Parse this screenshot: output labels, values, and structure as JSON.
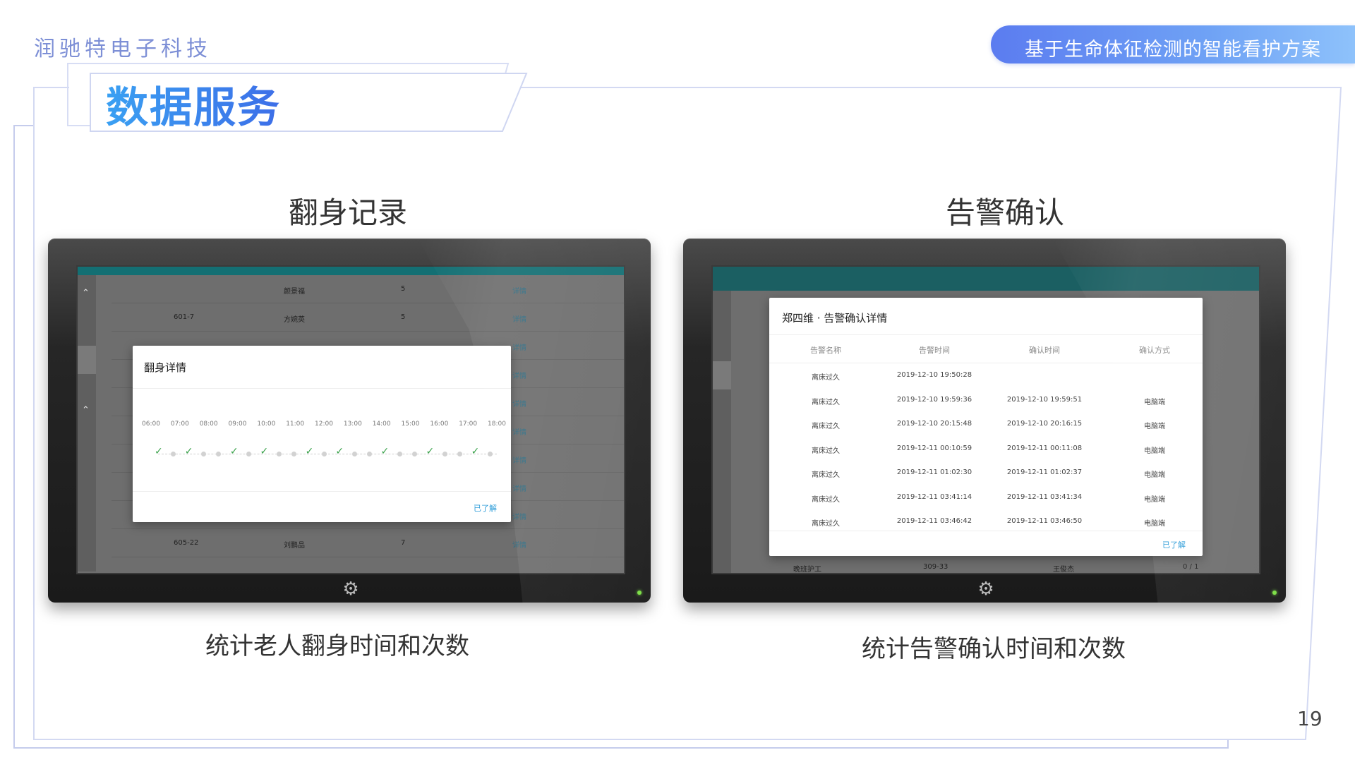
{
  "header": {
    "company": "润驰特电子科技",
    "tagline": "基于生命体征检测的智能看护方案"
  },
  "section_title": "数据服务",
  "page_number": "19",
  "colors": {
    "accent_blue": "#3d6ee8",
    "pill_start": "#5b7cf0",
    "pill_end": "#8ec2fb",
    "teal_bar": "#136f73",
    "check_green": "#3aa24b",
    "link_blue": "#2a9bd8"
  },
  "panel_left": {
    "heading": "翻身记录",
    "caption": "统计老人翻身时间和次数",
    "background_table": {
      "rows": [
        {
          "room": "",
          "name": "颜景福",
          "count": "5",
          "action": "详情"
        },
        {
          "room": "601-7",
          "name": "方婉英",
          "count": "5",
          "action": "详情"
        },
        {
          "room": "",
          "name": "",
          "count": "",
          "action": "详情"
        },
        {
          "room": "",
          "name": "",
          "count": "",
          "action": "详情"
        },
        {
          "room": "",
          "name": "",
          "count": "",
          "action": "详情"
        },
        {
          "room": "",
          "name": "",
          "count": "",
          "action": "详情"
        },
        {
          "room": "",
          "name": "",
          "count": "",
          "action": "详情"
        },
        {
          "room": "",
          "name": "",
          "count": "",
          "action": "详情"
        },
        {
          "room": "",
          "name": "",
          "count": "",
          "action": "详情"
        },
        {
          "room": "605-22",
          "name": "刘鹏品",
          "count": "7",
          "action": "详情"
        }
      ]
    },
    "dialog": {
      "title": "翻身详情",
      "times": [
        "06:00",
        "07:00",
        "08:00",
        "09:00",
        "10:00",
        "11:00",
        "12:00",
        "13:00",
        "14:00",
        "15:00",
        "16:00",
        "17:00",
        "18:00"
      ],
      "marks": [
        "check",
        "dot",
        "check",
        "dot",
        "dot",
        "check",
        "dot",
        "check",
        "dot",
        "dot",
        "check",
        "dot",
        "check",
        "dot",
        "dot",
        "check",
        "dot",
        "dot",
        "check",
        "dot",
        "dot",
        "check",
        "dot"
      ],
      "confirm_label": "已了解"
    }
  },
  "panel_right": {
    "heading": "告警确认",
    "caption": "统计告警确认时间和次数",
    "dialog": {
      "title": "郑四维 · 告警确认详情",
      "columns": [
        "告警名称",
        "告警时间",
        "确认时间",
        "确认方式"
      ],
      "rows": [
        [
          "离床过久",
          "2019-12-10 19:50:28",
          "",
          ""
        ],
        [
          "离床过久",
          "2019-12-10 19:59:36",
          "2019-12-10 19:59:51",
          "电脑端"
        ],
        [
          "离床过久",
          "2019-12-10 20:15:48",
          "2019-12-10 20:16:15",
          "电脑端"
        ],
        [
          "离床过久",
          "2019-12-11 00:10:59",
          "2019-12-11 00:11:08",
          "电脑端"
        ],
        [
          "离床过久",
          "2019-12-11 01:02:30",
          "2019-12-11 01:02:37",
          "电脑端"
        ],
        [
          "离床过久",
          "2019-12-11 03:41:14",
          "2019-12-11 03:41:34",
          "电脑端"
        ],
        [
          "离床过久",
          "2019-12-11 03:46:42",
          "2019-12-11 03:46:50",
          "电脑端"
        ]
      ],
      "confirm_label": "已了解"
    },
    "background_row": {
      "role": "晚班护工",
      "room": "309-33",
      "name": "王俊杰",
      "ratio": "0 / 1"
    }
  }
}
